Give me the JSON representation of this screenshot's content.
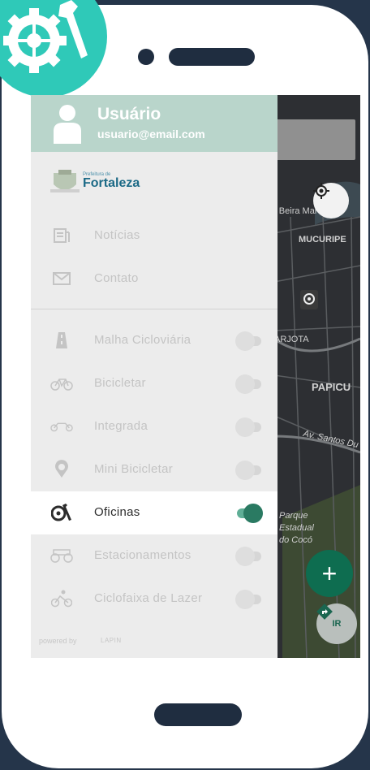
{
  "drawer": {
    "user_name": "Usuário",
    "user_email": "usuario@email.com",
    "pref_small": "Prefeitura de",
    "pref_big": "Fortaleza",
    "menu": [
      {
        "label": "Notícias",
        "icon": "newspaper-icon"
      },
      {
        "label": "Contato",
        "icon": "mail-icon"
      }
    ],
    "layers": [
      {
        "label": "Malha Cicloviária",
        "icon": "road-icon",
        "on": false
      },
      {
        "label": "Bicicletar",
        "icon": "bicycle-icon",
        "on": false
      },
      {
        "label": "Integrada",
        "icon": "tandem-bike-icon",
        "on": false
      },
      {
        "label": "Mini Bicicletar",
        "icon": "child-bike-icon",
        "on": false
      },
      {
        "label": "Oficinas",
        "icon": "gear-wrench-icon",
        "on": true
      },
      {
        "label": "Estacionamentos",
        "icon": "bike-parking-icon",
        "on": false
      },
      {
        "label": "Ciclofaixa de Lazer",
        "icon": "cyclist-icon",
        "on": false
      }
    ],
    "powered_by": "powered by",
    "lapin": "LAPIN"
  },
  "map": {
    "labels": {
      "beira_mar": "v. Beira Mar",
      "mucuripe": "MUCURIPE",
      "arjota": "ARJOTA",
      "papicu": "PAPICU",
      "santos_dumont": "Av. Santos Du",
      "parque": "Parque",
      "estadual": "Estadual",
      "coco": "do Cocó"
    },
    "go_label": "IR",
    "add_label": "+"
  },
  "colors": {
    "background": "#25354a",
    "accent": "#2fc9b8",
    "header": "#b9d5cb",
    "active_toggle": "#2a7a62",
    "fab": "#0e6d50"
  }
}
